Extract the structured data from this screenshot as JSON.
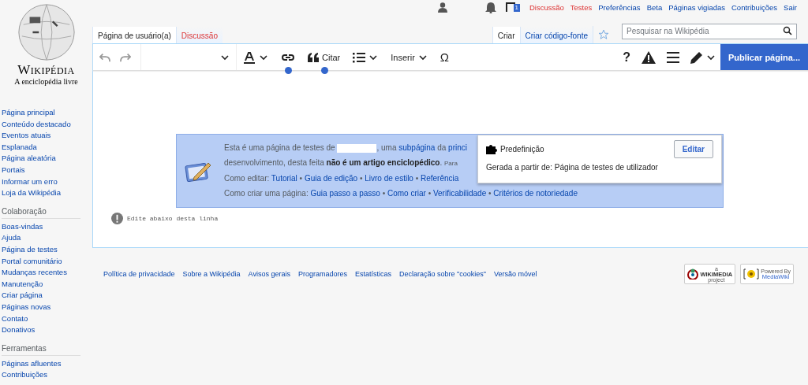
{
  "logo": {
    "wordmark": "Wikipédia",
    "tagline": "A enciclopédia livre"
  },
  "personal_tools": {
    "notification_count": "1",
    "links": [
      {
        "label": "Discussão",
        "missing": true
      },
      {
        "label": "Testes",
        "missing": true
      },
      {
        "label": "Preferências",
        "missing": false
      },
      {
        "label": "Beta",
        "missing": false
      },
      {
        "label": "Páginas vigiadas",
        "missing": false
      },
      {
        "label": "Contribuições",
        "missing": false
      },
      {
        "label": "Sair",
        "missing": false
      }
    ]
  },
  "namespace_tabs": [
    {
      "label": "Página de usuário(a)",
      "selected": true,
      "missing": false
    },
    {
      "label": "Discussão",
      "selected": false,
      "missing": true
    }
  ],
  "view_tabs": [
    {
      "label": "Criar",
      "selected": true
    },
    {
      "label": "Criar código-fonte",
      "selected": false
    }
  ],
  "search": {
    "placeholder": "Pesquisar na Wikipédia"
  },
  "toolbar": {
    "cite_label": "Citar",
    "insert_label": "Inserir",
    "special_char": "Ω",
    "help": "?",
    "publish": "Publicar página..."
  },
  "sidebar": [
    {
      "items": [
        "Página principal",
        "Conteúdo destacado",
        "Eventos atuais",
        "Esplanada",
        "Página aleatória",
        "Portais",
        "Informar um erro",
        "Loja da Wikipédia"
      ]
    },
    {
      "heading": "Colaboração",
      "items": [
        "Boas-vindas",
        "Ajuda",
        "Página de testes",
        "Portal comunitário",
        "Mudanças recentes",
        "Manutenção",
        "Criar página",
        "Páginas novas",
        "Contato",
        "Donativos"
      ]
    },
    {
      "heading": "Ferramentas",
      "items": [
        "Páginas afluentes",
        "Contribuições"
      ]
    }
  ],
  "notice": {
    "lines": [
      [
        {
          "kind": "text",
          "text": "Esta é uma página de testes de "
        },
        {
          "kind": "gap"
        },
        {
          "kind": "text",
          "text": ", uma "
        },
        {
          "kind": "link",
          "text": "subpágina"
        },
        {
          "kind": "text",
          "text": " da "
        },
        {
          "kind": "link",
          "text": "princi"
        }
      ],
      [
        {
          "kind": "text",
          "text": "desenvolvimento, desta feita **não é um artigo enciclopédico**. "
        },
        {
          "kind": "small",
          "text": "Para"
        }
      ],
      [
        {
          "kind": "text",
          "text": "Como editar: "
        },
        {
          "kind": "link",
          "text": "Tutorial"
        },
        {
          "kind": "text",
          "text": " • "
        },
        {
          "kind": "link",
          "text": "Guia de edição"
        },
        {
          "kind": "text",
          "text": " • "
        },
        {
          "kind": "link",
          "text": "Livro de estilo"
        },
        {
          "kind": "text",
          "text": " • "
        },
        {
          "kind": "link",
          "text": "Referência"
        }
      ],
      [
        {
          "kind": "text",
          "text": "Como criar uma página: "
        },
        {
          "kind": "link",
          "text": "Guia passo a passo"
        },
        {
          "kind": "text",
          "text": " • "
        },
        {
          "kind": "link",
          "text": "Como criar"
        },
        {
          "kind": "text",
          "text": " • "
        },
        {
          "kind": "link",
          "text": "Verificabilidade"
        },
        {
          "kind": "text",
          "text": " • "
        },
        {
          "kind": "link",
          "text": "Critérios de notoriedade"
        }
      ]
    ]
  },
  "template_popup": {
    "title": "Predefinição",
    "button": "Editar",
    "source": "Gerada a partir de: Página de testes de utilizador"
  },
  "edit_hint": "Edite abaixo desta linha",
  "footer": {
    "links": [
      "Política de privacidade",
      "Sobre a Wikipédia",
      "Avisos gerais",
      "Programadores",
      "Estatísticas",
      "Declaração sobre \"cookies\"",
      "Versão móvel"
    ],
    "badges": [
      {
        "kind": "wikimedia",
        "top": "a",
        "main": "WIKIMEDIA",
        "bottom": "project"
      },
      {
        "kind": "mediawiki",
        "top": "Powered By",
        "main": "MediaWiki"
      }
    ]
  }
}
